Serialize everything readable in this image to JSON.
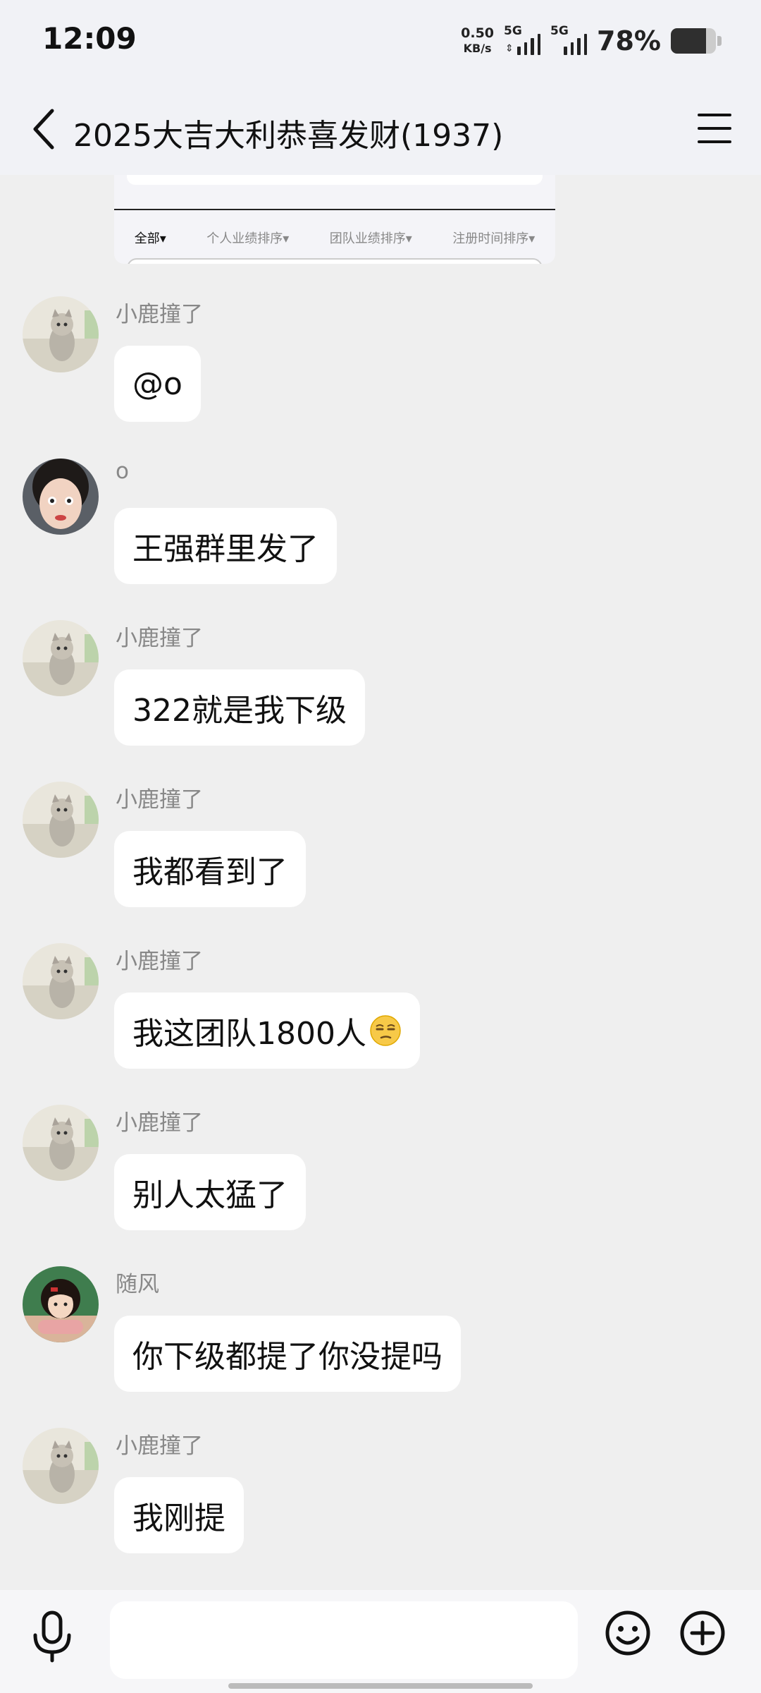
{
  "status_bar": {
    "time": "12:09",
    "net_speed_value": "0.50",
    "net_speed_unit": "KB/s",
    "sim1_label": "5G",
    "sim2_label": "5G",
    "battery_percent": "78%",
    "battery_level": 0.78
  },
  "header": {
    "title": "2025大吉大利恭喜发财(1937)"
  },
  "shared_image": {
    "tabs": [
      "全部",
      "个人业绩排序",
      "团队业绩排序",
      "注册时间排序"
    ]
  },
  "messages": [
    {
      "sender": "小鹿撞了",
      "text": "@o",
      "avatar": "cat-avatar"
    },
    {
      "sender": "o",
      "text": "王强群里发了",
      "avatar": "woman-avatar"
    },
    {
      "sender": "小鹿撞了",
      "text": "322就是我下级",
      "avatar": "cat-avatar"
    },
    {
      "sender": "小鹿撞了",
      "text": "我都看到了",
      "avatar": "cat-avatar"
    },
    {
      "sender": "小鹿撞了",
      "text": "我这团队1800人",
      "avatar": "cat-avatar",
      "emoji": "smirk-emoji"
    },
    {
      "sender": "小鹿撞了",
      "text": "别人太猛了",
      "avatar": "cat-avatar"
    },
    {
      "sender": "随风",
      "text": "你下级都提了你没提吗",
      "avatar": "anime-girl-avatar"
    },
    {
      "sender": "小鹿撞了",
      "text": "我刚提",
      "avatar": "cat-avatar"
    }
  ],
  "input_bar": {
    "placeholder": "",
    "icons": [
      "microphone-icon",
      "emoji-icon",
      "plus-icon"
    ]
  },
  "colors": {
    "background": "#efefef",
    "header_bg": "#f1f2f6",
    "bubble": "#ffffff",
    "sender_name": "#888888"
  }
}
